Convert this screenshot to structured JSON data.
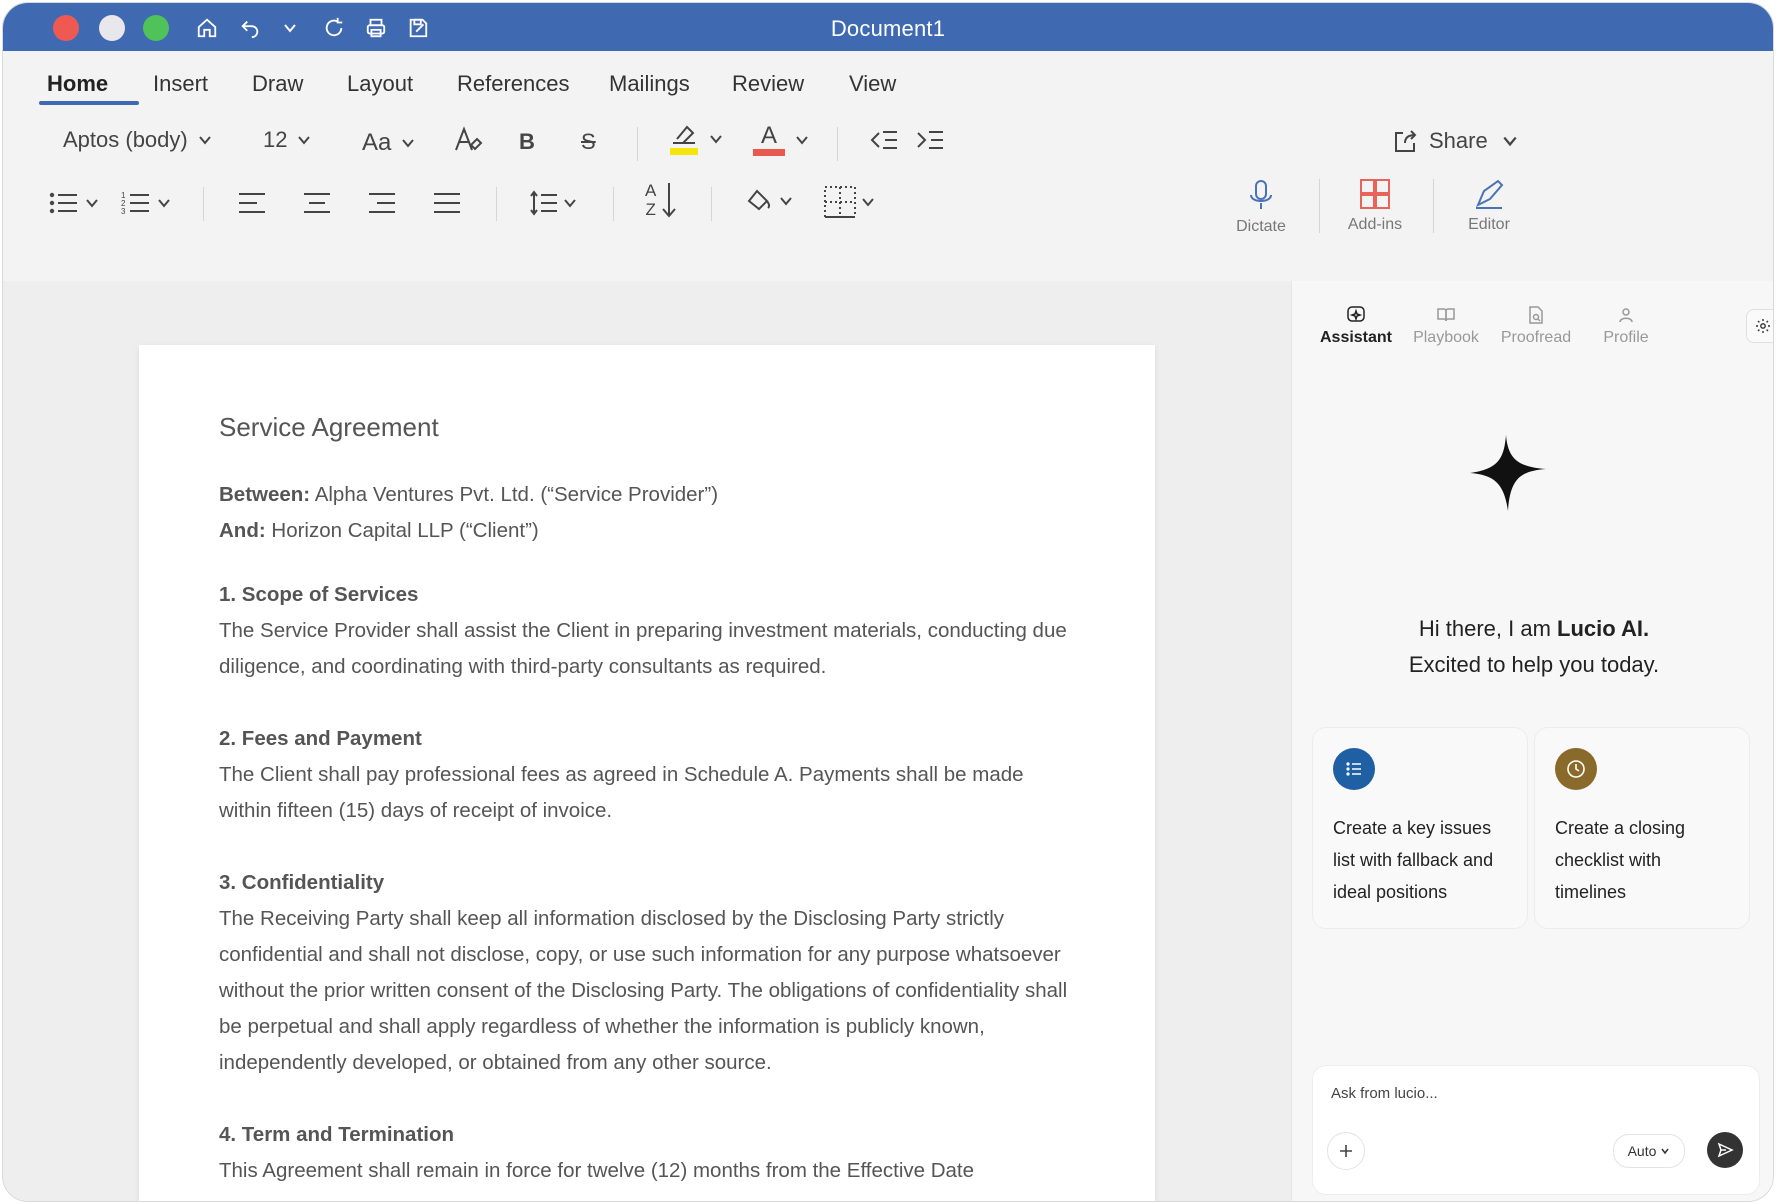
{
  "window": {
    "title": "Document1"
  },
  "tabs": [
    {
      "label": "Home",
      "active": true
    },
    {
      "label": "Insert"
    },
    {
      "label": "Draw"
    },
    {
      "label": "Layout"
    },
    {
      "label": "References"
    },
    {
      "label": "Mailings"
    },
    {
      "label": "Review"
    },
    {
      "label": "View"
    }
  ],
  "ribbon": {
    "font_name": "Aptos (body)",
    "font_size": "12",
    "change_case_label": "Aa",
    "bold_label": "B",
    "strike_label": "S",
    "font_color_label": "A",
    "highlight_color": "#f4e60b",
    "font_color": "#e85a4f",
    "share_label": "Share",
    "sort_top": "A",
    "sort_bottom": "Z",
    "dictate_label": "Dictate",
    "addins_label": "Add-ins",
    "editor_label": "Editor"
  },
  "document": {
    "heading": "Service Agreement",
    "between_label": "Between:",
    "between_text": " Alpha Ventures Pvt. Ltd. (“Service Provider”)",
    "and_label": "And:",
    "and_text": " Horizon Capital LLP (“Client”)",
    "sections": [
      {
        "title": "1. Scope of Services",
        "body": "The Service Provider shall assist the Client in preparing investment materials, conducting due diligence, and coordinating with third-party consultants as required."
      },
      {
        "title": "2. Fees and Payment",
        "body": "The Client shall pay professional fees as agreed in Schedule A. Payments shall be made within fifteen (15) days of receipt of invoice."
      },
      {
        "title": "3. Confidentiality",
        "body": "The Receiving Party shall keep all information disclosed by the Disclosing Party strictly confidential and shall not disclose, copy, or use such information for any purpose whatsoever without the prior written consent of the Disclosing Party. The obligations of confidentiality shall be perpetual and shall apply regardless of whether the information is publicly known, independently developed, or obtained from any other source."
      },
      {
        "title": "4. Term and Termination",
        "body": "This Agreement shall remain in force for twelve (12) months from the Effective Date"
      }
    ]
  },
  "panel": {
    "tabs": [
      {
        "label": "Assistant",
        "active": true
      },
      {
        "label": "Playbook"
      },
      {
        "label": "Proofread"
      },
      {
        "label": "Profile"
      }
    ],
    "greeting_line1_prefix": "Hi there, I am ",
    "greeting_name": "Lucio AI.",
    "greeting_line2": "Excited to help you today.",
    "cards": [
      {
        "text": "Create a key issues list with fallback and ideal positions",
        "icon": "list-icon",
        "color": "#1f5fa3"
      },
      {
        "text": "Create a closing checklist with timelines",
        "icon": "clock-icon",
        "color": "#8a6a2a"
      }
    ],
    "ask_placeholder": "Ask from lucio...",
    "auto_label": "Auto"
  }
}
